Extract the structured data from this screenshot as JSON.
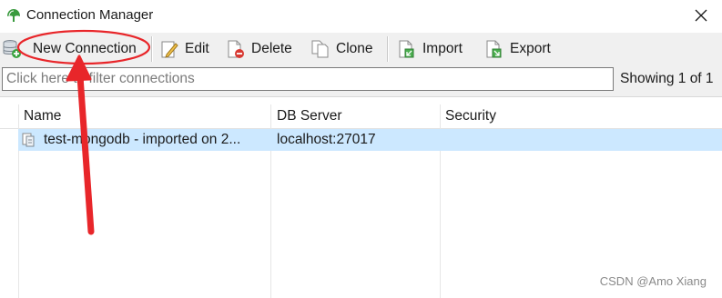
{
  "window": {
    "title": "Connection Manager",
    "app_icon": "mongo-leaf-icon",
    "close_icon": "close-icon"
  },
  "toolbar": {
    "new_connection": "New Connection",
    "edit": "Edit",
    "delete": "Delete",
    "clone": "Clone",
    "import": "Import",
    "export": "Export"
  },
  "filter": {
    "placeholder": "Click here to filter connections",
    "value": ""
  },
  "status": {
    "showing": "Showing 1 of 1"
  },
  "grid": {
    "columns": [
      "Name",
      "DB Server",
      "Security"
    ],
    "rows": [
      {
        "name": "test-mongodb - imported on 2...",
        "server": "localhost:27017",
        "security": ""
      }
    ]
  },
  "watermark": "CSDN @Amo Xiang",
  "colors": {
    "selection": "#cce8ff",
    "annotation": "#e8262a",
    "toolbar_bg": "#f0f0f0"
  }
}
